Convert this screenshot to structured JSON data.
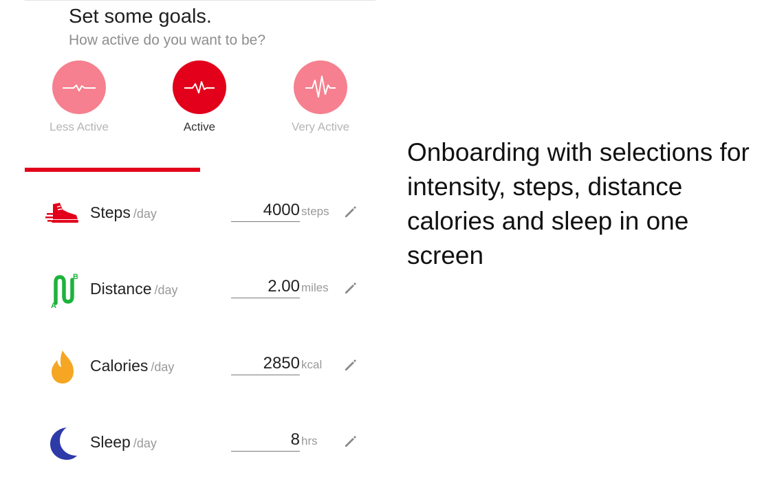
{
  "header": {
    "title": "Set some goals.",
    "subtitle": "How active do you want to be?"
  },
  "activity_levels": [
    {
      "label": "Less Active",
      "selected": false,
      "icon": "pulse-low-icon"
    },
    {
      "label": "Active",
      "selected": true,
      "icon": "pulse-medium-icon"
    },
    {
      "label": "Very Active",
      "selected": false,
      "icon": "pulse-high-icon"
    }
  ],
  "goals": [
    {
      "name": "Steps",
      "per": "/day",
      "value": "4000",
      "unit": "steps",
      "icon": "shoe-icon"
    },
    {
      "name": "Distance",
      "per": "/day",
      "value": "2.00",
      "unit": "miles",
      "icon": "route-icon"
    },
    {
      "name": "Calories",
      "per": "/day",
      "value": "2850",
      "unit": "kcal",
      "icon": "flame-icon"
    },
    {
      "name": "Sleep",
      "per": "/day",
      "value": "8",
      "unit": "hrs",
      "icon": "moon-icon"
    }
  ],
  "caption": "Onboarding with selections for intensity, steps, distance calories and sleep in one screen",
  "colors": {
    "accent_red": "#e2001a",
    "muted_pink": "#f6808f",
    "distance_green": "#1db33c",
    "flame_orange": "#f5a623",
    "moon_blue": "#2d3aa8"
  }
}
